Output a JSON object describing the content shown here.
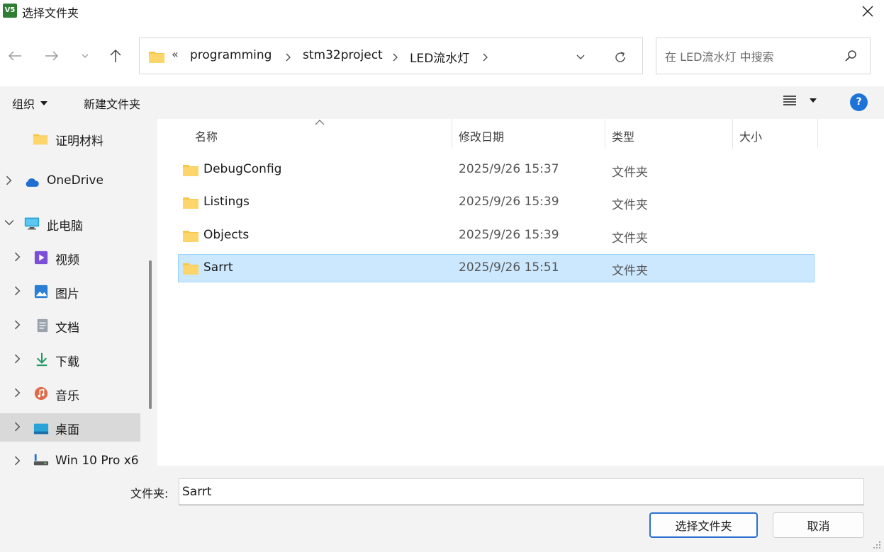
{
  "window": {
    "title": "选择文件夹",
    "app_icon_text": "V5"
  },
  "nav": {
    "breadcrumbs": [
      "programming",
      "stm32project",
      "LED流水灯"
    ],
    "overflow_glyph": "«"
  },
  "search": {
    "placeholder": "在 LED流水灯 中搜索"
  },
  "toolbar": {
    "organize_label": "组织",
    "new_folder_label": "新建文件夹",
    "help_label": "?"
  },
  "sidebar": {
    "items": [
      {
        "label": "证明材料",
        "icon": "folder-icon"
      },
      {
        "label": "OneDrive",
        "icon": "cloud-icon"
      },
      {
        "label": "此电脑",
        "icon": "monitor-icon"
      },
      {
        "label": "视频",
        "icon": "video-icon"
      },
      {
        "label": "图片",
        "icon": "picture-icon"
      },
      {
        "label": "文档",
        "icon": "document-icon"
      },
      {
        "label": "下载",
        "icon": "download-icon"
      },
      {
        "label": "音乐",
        "icon": "music-icon"
      },
      {
        "label": "桌面",
        "icon": "desktop-icon"
      },
      {
        "label": "Win 10 Pro x6",
        "icon": "drive-icon"
      }
    ],
    "active_item": "桌面"
  },
  "columns": {
    "name": "名称",
    "modified": "修改日期",
    "type": "类型",
    "size": "大小"
  },
  "files": [
    {
      "name": "DebugConfig",
      "modified": "2025/9/26 15:37",
      "type": "文件夹",
      "size": ""
    },
    {
      "name": "Listings",
      "modified": "2025/9/26 15:39",
      "type": "文件夹",
      "size": ""
    },
    {
      "name": "Objects",
      "modified": "2025/9/26 15:39",
      "type": "文件夹",
      "size": ""
    },
    {
      "name": "Sarrt",
      "modified": "2025/9/26 15:51",
      "type": "文件夹",
      "size": ""
    }
  ],
  "selected_file": "Sarrt",
  "footer": {
    "folder_label": "文件夹:",
    "folder_value": "Sarrt",
    "select_button": "选择文件夹",
    "cancel_button": "取消"
  },
  "colors": {
    "accent": "#1e73d8",
    "selection": "#cce8ff",
    "folder": "#f8c64a"
  }
}
